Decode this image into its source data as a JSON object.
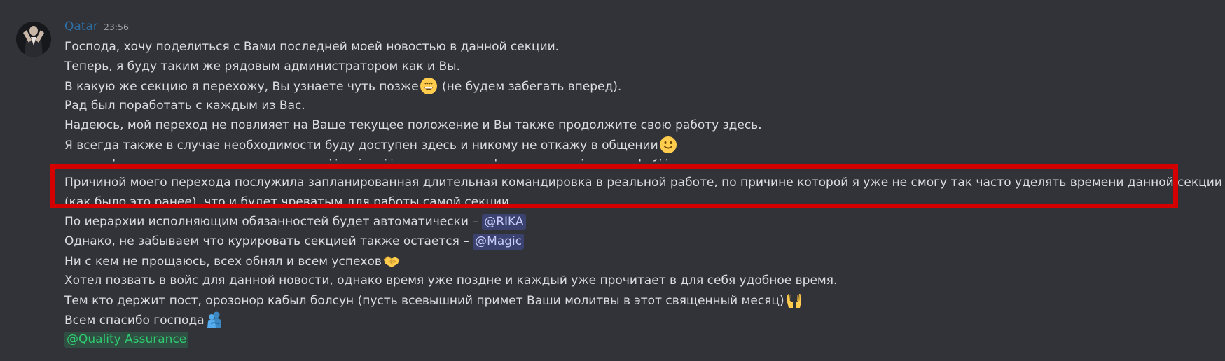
{
  "message": {
    "author": "Qatar",
    "timestamp": "23:56",
    "author_color": "#2e6fa6",
    "avatar_icon": "avatar-icon",
    "lines": {
      "l1": "Господа, хочу поделиться с Вами последней моей новостью в данной секции.",
      "l2": "Теперь, я буду таким же рядовым администратором как и Вы.",
      "l3a": "В какую же секцию я перехожу, Вы узнаете чуть позже",
      "l3b": " (не будем забегать вперед).",
      "l4": "Рад был поработать с каждым из Вас.",
      "l5": "Надеюсь, мой переход не повлияет на Ваше текущее положение и Вы также продолжите свою работу здесь.",
      "l6": "Я всегда также в случае необходимости буду доступен здесь и никому не откажу в общении",
      "l7": "Я постарался оставить свой основной ... здесь, и одним из них который этот секционный флуд",
      "l8": "Причиной моего перехода послужила запланированная длительная командировка в реальной работе, по причине которой я уже не смогу так часто уделять времени данной секции",
      "l9": "(как было это ранее), что и будет чреватым для работы самой секции.",
      "l10a": "По иерархии исполняющим обязанностей будет автоматически – ",
      "l10_mention": "@RIKA",
      "l11a": "Однако, не забываем что курировать секцией также остается – ",
      "l11_mention": "@Magic",
      "l12": "Ни с кем не прощаюсь, всех обнял и всем успехов",
      "l13": "Хотел позвать в войс для данной новости, однако время уже поздне и каждый уже прочитает в для себя удобное время.",
      "l14": "Тем кто держит пост, орозонор кабыл болсун (пусть всевышний примет Ваши молитвы в этот священный месяц)",
      "l15": "Всем спасибо господа",
      "l16_role": "@Quality Assurance"
    },
    "emojis": {
      "grin": "grinning-emoji",
      "smile": "slight-smile-emoji",
      "handshake": "handshake-emoji",
      "palms": "palms-up-emoji",
      "hug": "hugging-people-emoji"
    }
  },
  "annotation": {
    "box_color": "#d40000"
  }
}
